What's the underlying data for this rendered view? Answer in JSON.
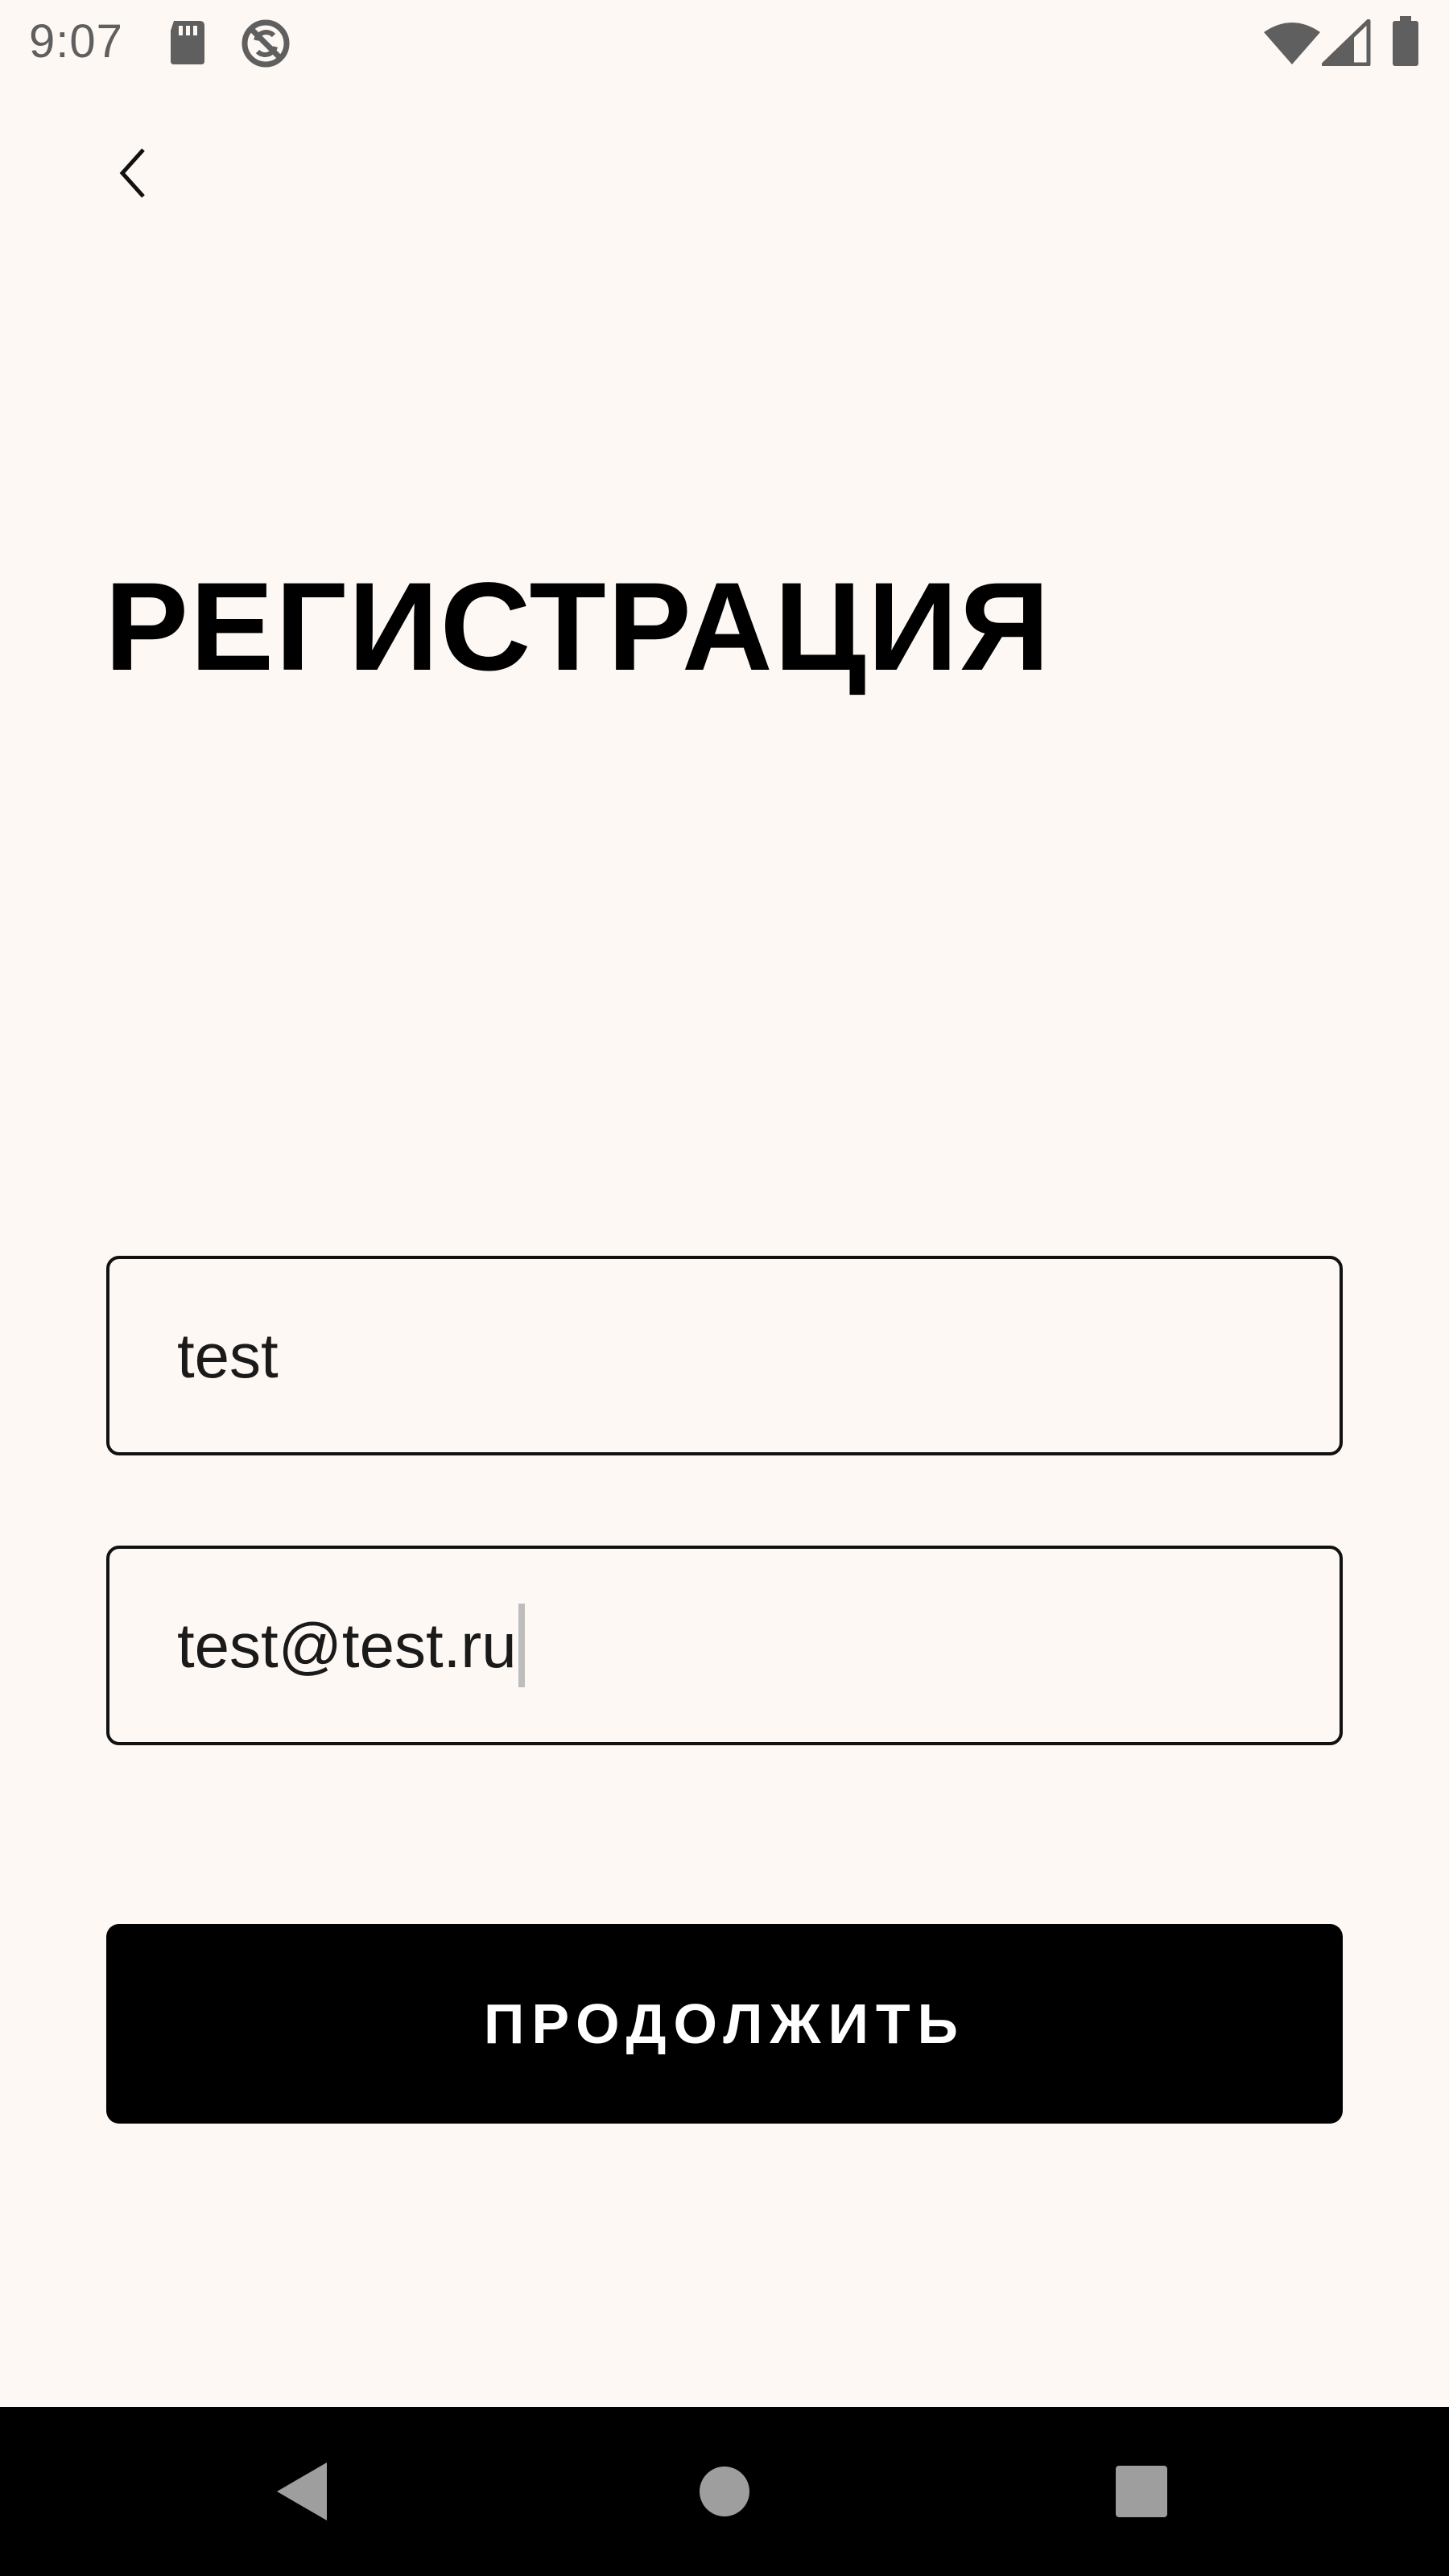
{
  "status_bar": {
    "time": "9:07",
    "icons": [
      "sd-card-icon",
      "no-sync-icon",
      "wifi-icon",
      "cell-signal-icon",
      "battery-icon"
    ]
  },
  "header": {
    "back_icon": "chevron-left-icon"
  },
  "page": {
    "title": "РЕГИСТРАЦИЯ"
  },
  "form": {
    "name_value": "test",
    "email_value": "test@test.ru",
    "continue_label": "ПРОДОЛЖИТЬ"
  },
  "nav_bar": {
    "icons": [
      "nav-back-icon",
      "nav-home-icon",
      "nav-recents-icon"
    ]
  },
  "colors": {
    "background": "#fdf8f3",
    "primary_button": "#000000",
    "text": "#000000",
    "status_icons": "#5f5f5f"
  }
}
